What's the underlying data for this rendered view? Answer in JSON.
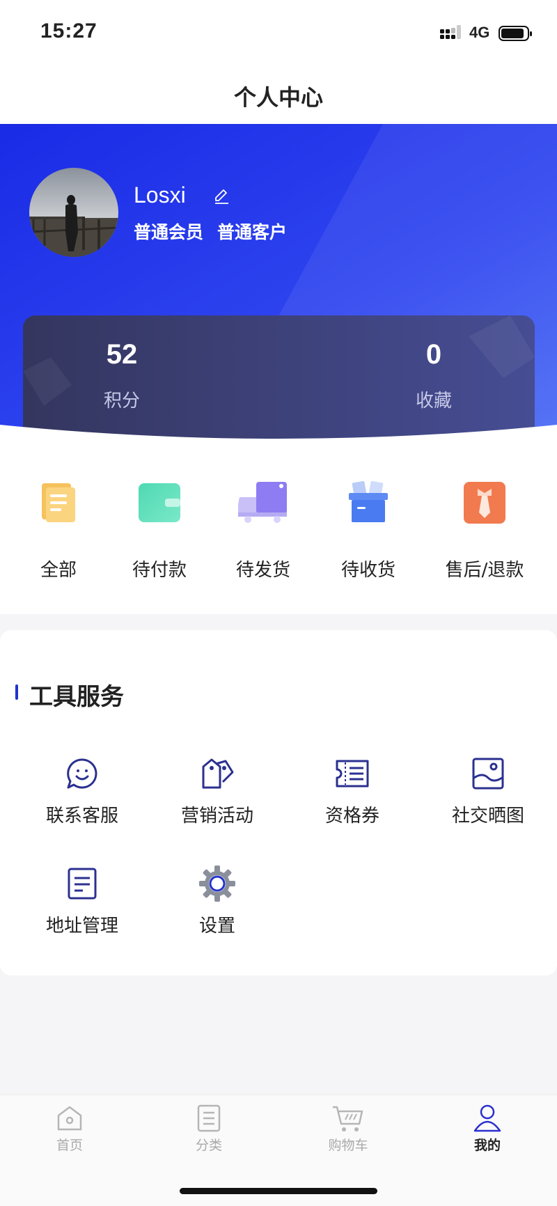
{
  "status_bar": {
    "time": "15:27",
    "network": "4G"
  },
  "nav": {
    "title": "个人中心"
  },
  "profile": {
    "username": "Losxi",
    "badges": [
      "普通会员",
      "普通客户"
    ]
  },
  "stats": [
    {
      "value": "52",
      "label": "积分"
    },
    {
      "value": "0",
      "label": "收藏"
    }
  ],
  "orders": [
    {
      "label": "全部",
      "icon": "scroll-icon"
    },
    {
      "label": "待付款",
      "icon": "wallet-icon"
    },
    {
      "label": "待发货",
      "icon": "truck-icon"
    },
    {
      "label": "待收货",
      "icon": "box-icon"
    },
    {
      "label": "售后/退款",
      "icon": "tie-icon"
    }
  ],
  "tools": {
    "title": "工具服务",
    "items": [
      {
        "label": "联系客服",
        "icon": "chat-smile-icon"
      },
      {
        "label": "营销活动",
        "icon": "tags-icon"
      },
      {
        "label": "资格券",
        "icon": "ticket-icon"
      },
      {
        "label": "社交晒图",
        "icon": "image-icon"
      },
      {
        "label": "地址管理",
        "icon": "document-icon"
      },
      {
        "label": "设置",
        "icon": "gear-icon"
      }
    ]
  },
  "tab_bar": {
    "items": [
      {
        "label": "首页",
        "icon": "home-icon",
        "active": false
      },
      {
        "label": "分类",
        "icon": "list-icon",
        "active": false
      },
      {
        "label": "购物车",
        "icon": "cart-icon",
        "active": false
      },
      {
        "label": "我的",
        "icon": "user-icon",
        "active": true
      }
    ]
  },
  "colors": {
    "accent": "#2233ee",
    "header_gradient_end": "#4a6cf5",
    "active_tab": "#2a2fcf"
  }
}
